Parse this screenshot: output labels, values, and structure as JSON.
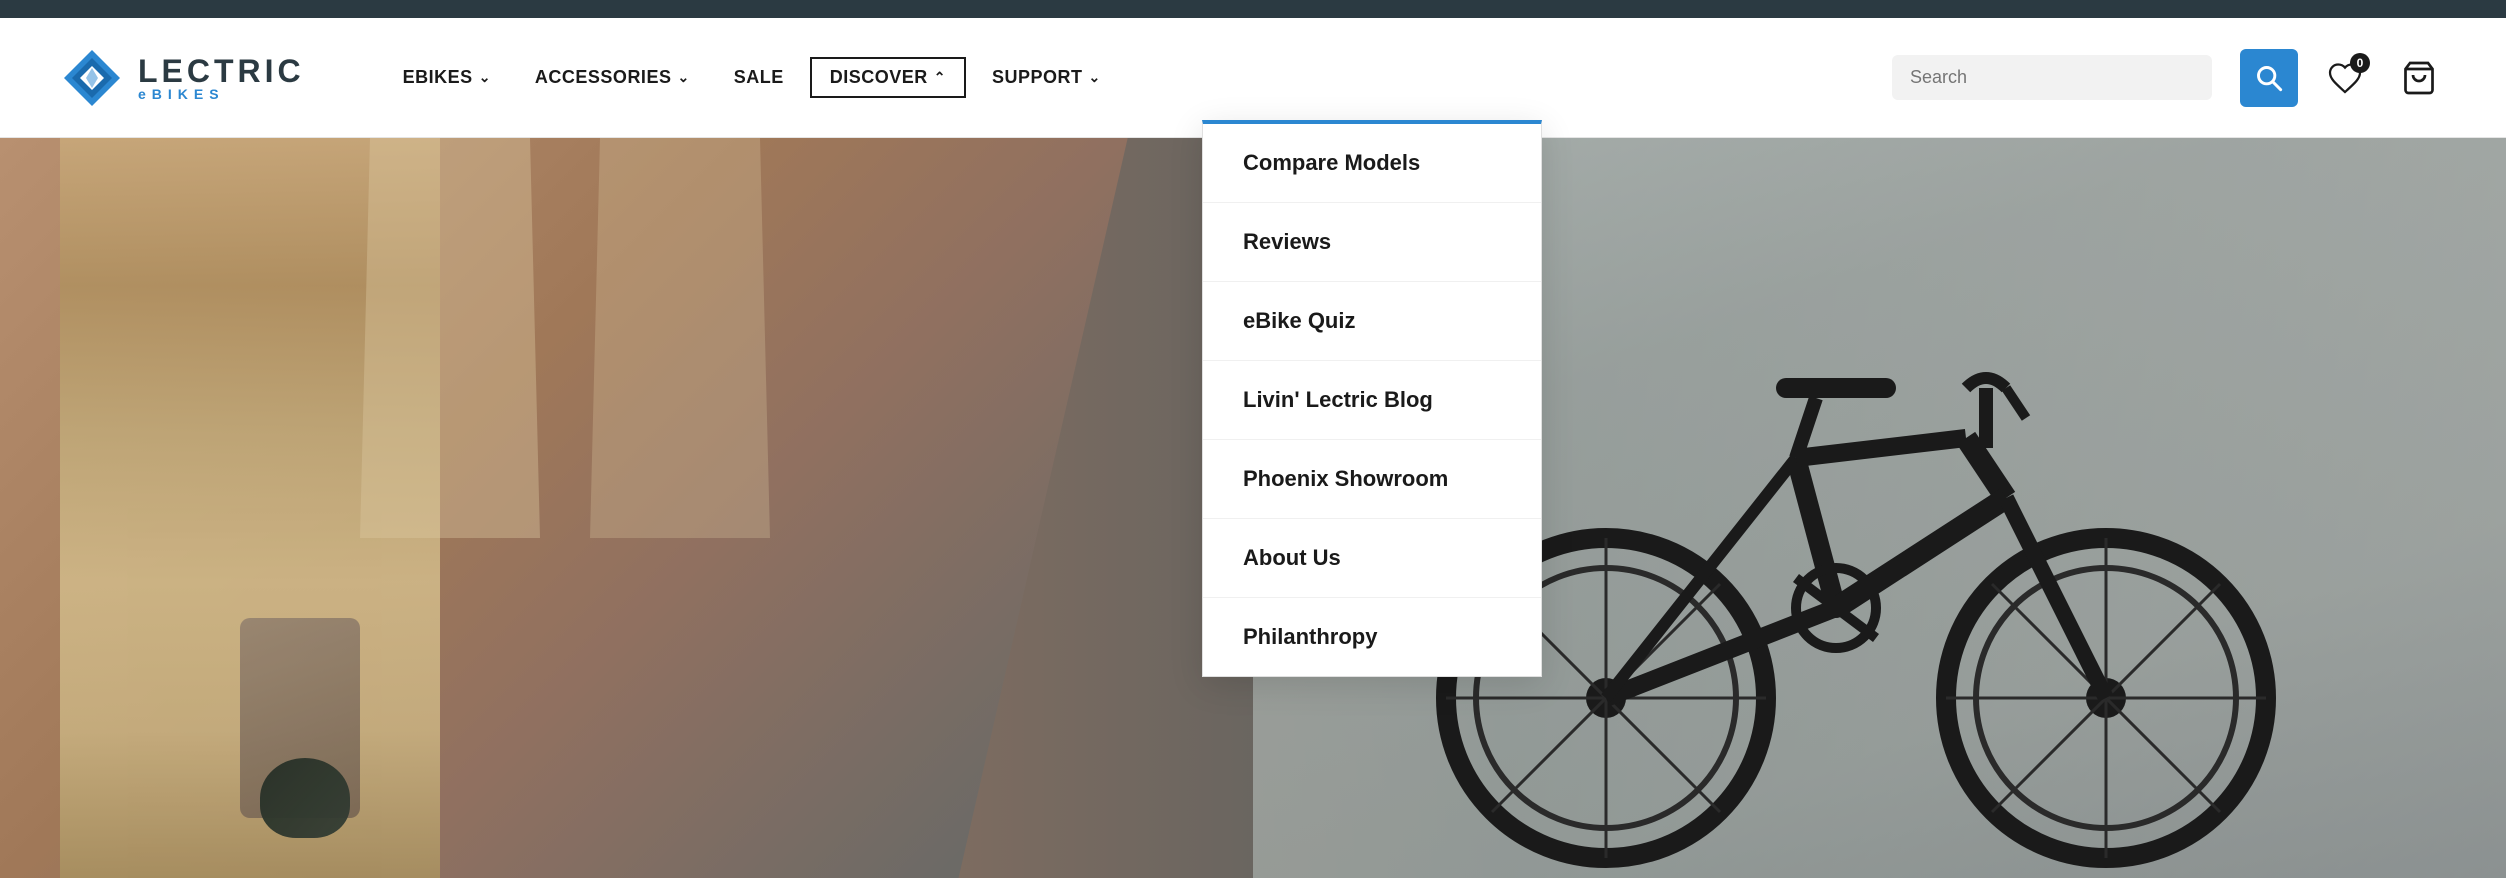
{
  "topbar": {},
  "header": {
    "logo": {
      "lectric": "LECTRIC",
      "ebikes": "eBIKES"
    },
    "nav": {
      "ebikes_label": "eBIKES",
      "accessories_label": "ACCESSORIES",
      "sale_label": "SALE",
      "discover_label": "DISCOVER",
      "support_label": "SUPPORT"
    },
    "search": {
      "placeholder": "Search"
    },
    "wishlist_badge": "0",
    "cart_label": "Cart"
  },
  "dropdown": {
    "items": [
      {
        "label": "Compare Models",
        "key": "compare-models"
      },
      {
        "label": "Reviews",
        "key": "reviews"
      },
      {
        "label": "eBike Quiz",
        "key": "ebike-quiz"
      },
      {
        "label": "Livin' Lectric Blog",
        "key": "blog"
      },
      {
        "label": "Phoenix Showroom",
        "key": "phoenix-showroom"
      },
      {
        "label": "About Us",
        "key": "about-us"
      },
      {
        "label": "Philanthropy",
        "key": "philanthropy"
      }
    ]
  }
}
